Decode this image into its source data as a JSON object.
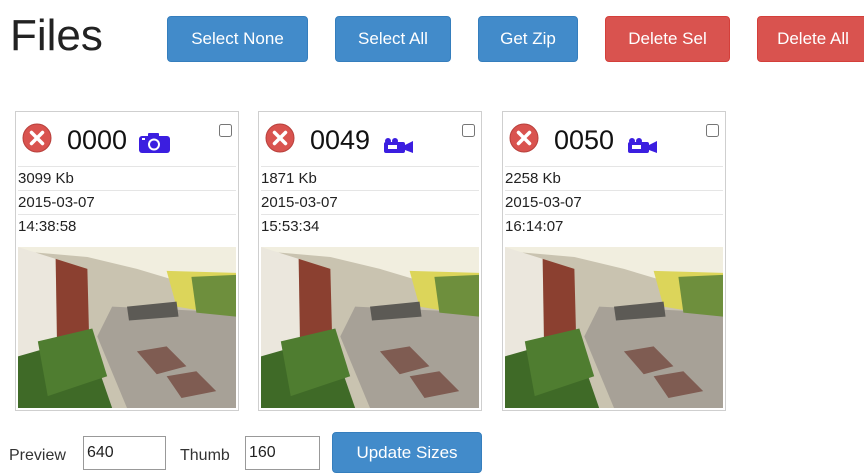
{
  "page": {
    "title": "Files"
  },
  "toolbar": {
    "select_none": "Select None",
    "select_all": "Select All",
    "get_zip": "Get Zip",
    "delete_sel": "Delete Sel",
    "delete_all": "Delete All"
  },
  "files": [
    {
      "number": "0000",
      "media": "camera-icon",
      "size": "3099 Kb",
      "date": "2015-03-07",
      "time": "14:38:58"
    },
    {
      "number": "0049",
      "media": "video-camera-icon",
      "size": "1871 Kb",
      "date": "2015-03-07",
      "time": "15:53:34"
    },
    {
      "number": "0050",
      "media": "video-camera-icon",
      "size": "2258 Kb",
      "date": "2015-03-07",
      "time": "16:14:07"
    }
  ],
  "sizes": {
    "preview_label": "Preview",
    "preview_value": "640",
    "thumb_label": "Thumb",
    "thumb_value": "160",
    "update_label": "Update Sizes"
  },
  "colors": {
    "primary": "#428bca",
    "danger": "#d9534f",
    "media_icon": "#3b1ee0"
  }
}
